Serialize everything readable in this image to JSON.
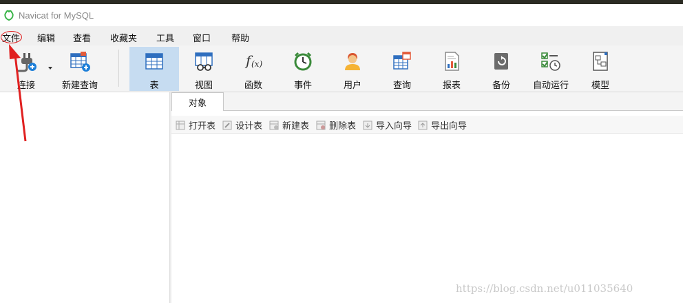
{
  "window": {
    "title": "Navicat for MySQL"
  },
  "menu": {
    "items": [
      "文件",
      "编辑",
      "查看",
      "收藏夹",
      "工具",
      "窗口",
      "帮助"
    ]
  },
  "toolbar": {
    "connect": "连接",
    "new_query": "新建查询",
    "items": [
      "表",
      "视图",
      "函数",
      "事件",
      "用户",
      "查询",
      "报表",
      "备份",
      "自动运行",
      "模型"
    ],
    "active": "表"
  },
  "tabs": {
    "objects": "对象"
  },
  "object_toolbar": {
    "items": [
      "打开表",
      "设计表",
      "新建表",
      "删除表",
      "导入向导",
      "导出向导"
    ]
  },
  "watermark": "https://blog.csdn.net/u011035640",
  "colors": {
    "accent": "#c6dcf1",
    "annotation": "#e02020"
  },
  "icons": {
    "connect": "plug-icon",
    "new_query": "table-add-icon",
    "table": "table-icon",
    "view": "view-glasses-icon",
    "function": "function-fx-icon",
    "event": "alarm-clock-icon",
    "user": "user-icon",
    "query": "query-table-icon",
    "report": "report-icon",
    "backup": "backup-icon",
    "schedule": "schedule-icon",
    "model": "model-icon"
  }
}
